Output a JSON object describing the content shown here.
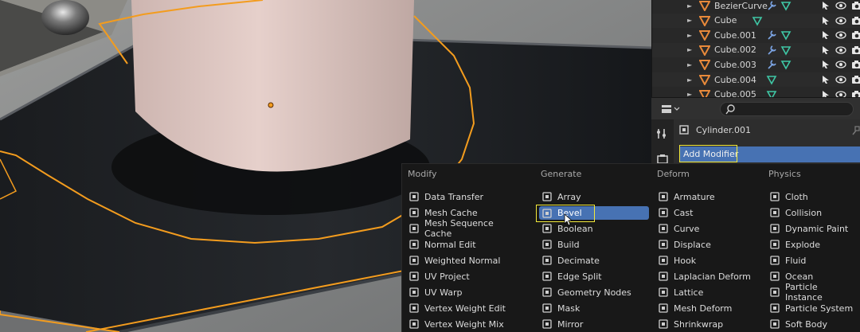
{
  "outliner": {
    "items": [
      {
        "name": "BezierCurve",
        "mod": true,
        "icon": "curve-data-icon"
      },
      {
        "name": "Cube",
        "mod": false
      },
      {
        "name": "Cube.001",
        "mod": true
      },
      {
        "name": "Cube.002",
        "mod": true
      },
      {
        "name": "Cube.003",
        "mod": true
      },
      {
        "name": "Cube.004",
        "mod": false
      },
      {
        "name": "Cube.005",
        "mod": false
      }
    ]
  },
  "properties": {
    "object_name": "Cylinder.001",
    "add_modifier_label": "Add Modifier",
    "search_placeholder": ""
  },
  "menu": {
    "columns": [
      {
        "heading": "Modify",
        "items": [
          "Data Transfer",
          "Mesh Cache",
          "Mesh Sequence Cache",
          "Normal Edit",
          "Weighted Normal",
          "UV Project",
          "UV Warp",
          "Vertex Weight Edit",
          "Vertex Weight Mix"
        ]
      },
      {
        "heading": "Generate",
        "items": [
          "Array",
          "Bevel",
          "Boolean",
          "Build",
          "Decimate",
          "Edge Split",
          "Geometry Nodes",
          "Mask",
          "Mirror"
        ]
      },
      {
        "heading": "Deform",
        "items": [
          "Armature",
          "Cast",
          "Curve",
          "Displace",
          "Hook",
          "Laplacian Deform",
          "Lattice",
          "Mesh Deform",
          "Shrinkwrap"
        ]
      },
      {
        "heading": "Physics",
        "items": [
          "Cloth",
          "Collision",
          "Dynamic Paint",
          "Explode",
          "Fluid",
          "Ocean",
          "Particle Instance",
          "Particle System",
          "Soft Body"
        ]
      }
    ],
    "active_item": "Bevel"
  },
  "colors": {
    "accent": "#4772b3",
    "highlight": "#f3ea3a",
    "selection_outline": "#f39c1e",
    "object_orange": "#e8893a",
    "mesh_teal": "#3fc8a6",
    "modifier_blue": "#7da6e6"
  }
}
